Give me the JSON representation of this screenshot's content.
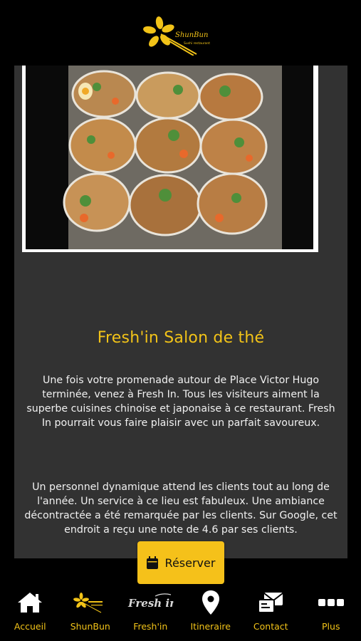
{
  "header": {
    "logo_name": "ShunBun",
    "logo_tagline": "Sushi restaurant"
  },
  "hero": {
    "image_alt": "Bowls of food"
  },
  "content": {
    "title": "Fresh'in Salon de thé",
    "paragraph_1": "Une fois votre promenade autour de Place Victor Hugo terminée, venez à Fresh In. Tous les visiteurs aiment la superbe cuisines chinoise et japonaise à ce restaurant. Fresh In pourrait vous faire plaisir avec un parfait savoureux.",
    "paragraph_2": "Un personnel dynamique attend les clients tout au long de l'année. Un service à ce lieu est fabuleux. Une ambiance décontractée a été remarquée par les clients. Sur Google, cet endroit a reçu une note de 4.6 par ses clients."
  },
  "reserve": {
    "label": "Réserver",
    "icon": "calendar-icon"
  },
  "tabs": [
    {
      "label": "Accueil",
      "icon": "home-icon"
    },
    {
      "label": "ShunBun",
      "icon": "shunbun-logo-icon"
    },
    {
      "label": "Fresh'in",
      "icon": "freshin-logo-icon",
      "logo_text": "Fresh in"
    },
    {
      "label": "Itineraire",
      "icon": "map-pin-icon"
    },
    {
      "label": "Contact",
      "icon": "contact-icon"
    },
    {
      "label": "Plus",
      "icon": "more-icon"
    }
  ],
  "colors": {
    "accent": "#f2c318",
    "card_bg": "#323232",
    "page_bg": "#000000",
    "button_bg": "#f5c11a"
  }
}
